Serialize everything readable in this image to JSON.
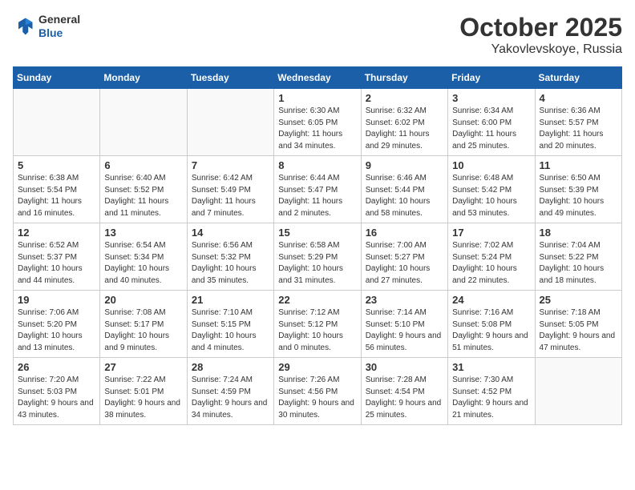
{
  "header": {
    "logo_general": "General",
    "logo_blue": "Blue",
    "month_title": "October 2025",
    "location": "Yakovlevskoye, Russia"
  },
  "days_of_week": [
    "Sunday",
    "Monday",
    "Tuesday",
    "Wednesday",
    "Thursday",
    "Friday",
    "Saturday"
  ],
  "weeks": [
    [
      {
        "day": "",
        "info": ""
      },
      {
        "day": "",
        "info": ""
      },
      {
        "day": "",
        "info": ""
      },
      {
        "day": "1",
        "info": "Sunrise: 6:30 AM\nSunset: 6:05 PM\nDaylight: 11 hours\nand 34 minutes."
      },
      {
        "day": "2",
        "info": "Sunrise: 6:32 AM\nSunset: 6:02 PM\nDaylight: 11 hours\nand 29 minutes."
      },
      {
        "day": "3",
        "info": "Sunrise: 6:34 AM\nSunset: 6:00 PM\nDaylight: 11 hours\nand 25 minutes."
      },
      {
        "day": "4",
        "info": "Sunrise: 6:36 AM\nSunset: 5:57 PM\nDaylight: 11 hours\nand 20 minutes."
      }
    ],
    [
      {
        "day": "5",
        "info": "Sunrise: 6:38 AM\nSunset: 5:54 PM\nDaylight: 11 hours\nand 16 minutes."
      },
      {
        "day": "6",
        "info": "Sunrise: 6:40 AM\nSunset: 5:52 PM\nDaylight: 11 hours\nand 11 minutes."
      },
      {
        "day": "7",
        "info": "Sunrise: 6:42 AM\nSunset: 5:49 PM\nDaylight: 11 hours\nand 7 minutes."
      },
      {
        "day": "8",
        "info": "Sunrise: 6:44 AM\nSunset: 5:47 PM\nDaylight: 11 hours\nand 2 minutes."
      },
      {
        "day": "9",
        "info": "Sunrise: 6:46 AM\nSunset: 5:44 PM\nDaylight: 10 hours\nand 58 minutes."
      },
      {
        "day": "10",
        "info": "Sunrise: 6:48 AM\nSunset: 5:42 PM\nDaylight: 10 hours\nand 53 minutes."
      },
      {
        "day": "11",
        "info": "Sunrise: 6:50 AM\nSunset: 5:39 PM\nDaylight: 10 hours\nand 49 minutes."
      }
    ],
    [
      {
        "day": "12",
        "info": "Sunrise: 6:52 AM\nSunset: 5:37 PM\nDaylight: 10 hours\nand 44 minutes."
      },
      {
        "day": "13",
        "info": "Sunrise: 6:54 AM\nSunset: 5:34 PM\nDaylight: 10 hours\nand 40 minutes."
      },
      {
        "day": "14",
        "info": "Sunrise: 6:56 AM\nSunset: 5:32 PM\nDaylight: 10 hours\nand 35 minutes."
      },
      {
        "day": "15",
        "info": "Sunrise: 6:58 AM\nSunset: 5:29 PM\nDaylight: 10 hours\nand 31 minutes."
      },
      {
        "day": "16",
        "info": "Sunrise: 7:00 AM\nSunset: 5:27 PM\nDaylight: 10 hours\nand 27 minutes."
      },
      {
        "day": "17",
        "info": "Sunrise: 7:02 AM\nSunset: 5:24 PM\nDaylight: 10 hours\nand 22 minutes."
      },
      {
        "day": "18",
        "info": "Sunrise: 7:04 AM\nSunset: 5:22 PM\nDaylight: 10 hours\nand 18 minutes."
      }
    ],
    [
      {
        "day": "19",
        "info": "Sunrise: 7:06 AM\nSunset: 5:20 PM\nDaylight: 10 hours\nand 13 minutes."
      },
      {
        "day": "20",
        "info": "Sunrise: 7:08 AM\nSunset: 5:17 PM\nDaylight: 10 hours\nand 9 minutes."
      },
      {
        "day": "21",
        "info": "Sunrise: 7:10 AM\nSunset: 5:15 PM\nDaylight: 10 hours\nand 4 minutes."
      },
      {
        "day": "22",
        "info": "Sunrise: 7:12 AM\nSunset: 5:12 PM\nDaylight: 10 hours\nand 0 minutes."
      },
      {
        "day": "23",
        "info": "Sunrise: 7:14 AM\nSunset: 5:10 PM\nDaylight: 9 hours\nand 56 minutes."
      },
      {
        "day": "24",
        "info": "Sunrise: 7:16 AM\nSunset: 5:08 PM\nDaylight: 9 hours\nand 51 minutes."
      },
      {
        "day": "25",
        "info": "Sunrise: 7:18 AM\nSunset: 5:05 PM\nDaylight: 9 hours\nand 47 minutes."
      }
    ],
    [
      {
        "day": "26",
        "info": "Sunrise: 7:20 AM\nSunset: 5:03 PM\nDaylight: 9 hours\nand 43 minutes."
      },
      {
        "day": "27",
        "info": "Sunrise: 7:22 AM\nSunset: 5:01 PM\nDaylight: 9 hours\nand 38 minutes."
      },
      {
        "day": "28",
        "info": "Sunrise: 7:24 AM\nSunset: 4:59 PM\nDaylight: 9 hours\nand 34 minutes."
      },
      {
        "day": "29",
        "info": "Sunrise: 7:26 AM\nSunset: 4:56 PM\nDaylight: 9 hours\nand 30 minutes."
      },
      {
        "day": "30",
        "info": "Sunrise: 7:28 AM\nSunset: 4:54 PM\nDaylight: 9 hours\nand 25 minutes."
      },
      {
        "day": "31",
        "info": "Sunrise: 7:30 AM\nSunset: 4:52 PM\nDaylight: 9 hours\nand 21 minutes."
      },
      {
        "day": "",
        "info": ""
      }
    ]
  ]
}
